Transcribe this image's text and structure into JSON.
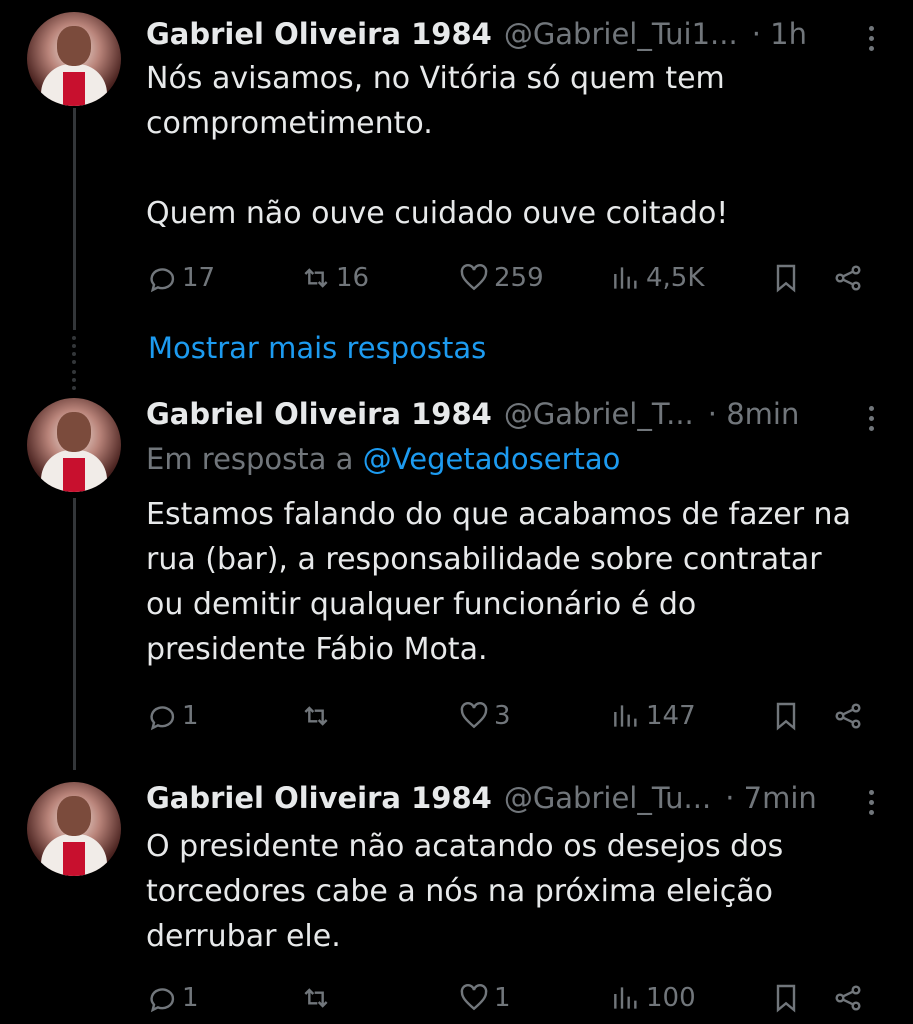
{
  "tweets": [
    {
      "name": "Gabriel Oliveira 1984",
      "handle": "@Gabriel_Tui1...",
      "time": "· 1h",
      "reply_prefix": "",
      "reply_mention": "",
      "text_lines": [
        "Nós avisamos, no Vitória só quem tem",
        "comprometimento.",
        "",
        "Quem não ouve cuidado ouve coitado!"
      ],
      "replies": "17",
      "reposts": "16",
      "likes": "259",
      "views": "4,5K"
    },
    {
      "name": "Gabriel Oliveira 1984",
      "handle": "@Gabriel_T...",
      "time": "· 8min",
      "reply_prefix": "Em resposta a ",
      "reply_mention": "@Vegetadosertao",
      "text_lines": [
        "Estamos falando do que acabamos de fazer na",
        "rua (bar), a responsabilidade sobre contratar",
        "ou demitir qualquer funcionário é do",
        "presidente Fábio Mota."
      ],
      "replies": "1",
      "reposts": "",
      "likes": "3",
      "views": "147"
    },
    {
      "name": "Gabriel Oliveira 1984",
      "handle": "@Gabriel_Tu...",
      "time": "· 7min",
      "reply_prefix": "",
      "reply_mention": "",
      "text_lines": [
        "O presidente não acatando os desejos dos",
        "torcedores cabe a nós na próxima eleição",
        "derrubar ele."
      ],
      "replies": "1",
      "reposts": "",
      "likes": "1",
      "views": "100"
    }
  ],
  "show_more_label": "Mostrar mais respostas",
  "colors": {
    "background": "#000000",
    "text": "#e7e9ea",
    "muted": "#71767b",
    "link": "#1d9bf0"
  },
  "icons": [
    "reply-icon",
    "repost-icon",
    "like-icon",
    "views-icon",
    "bookmark-icon",
    "share-icon",
    "more-options-icon"
  ]
}
